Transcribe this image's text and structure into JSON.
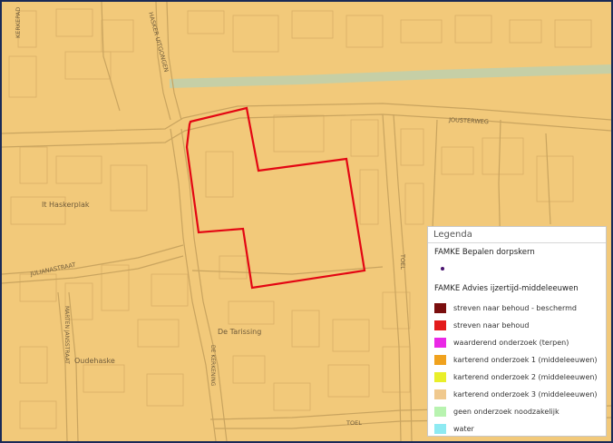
{
  "map": {
    "street_labels": {
      "kerkepad": "KERKEPAD",
      "haskerdijken": "HASKER UITGONGEN",
      "jousterweg": "JOUSTERWEG",
      "it_haskerplak": "It Haskerplak",
      "julianastraat": "JULIANASTRAAT",
      "toel_east": "TOEL",
      "marten": "MARTEN JANSSTRAAT",
      "oudehaske": "Oudehaske",
      "de_tarissing": "De Tarissing",
      "de_kerkening": "DE KERKENING",
      "toel_south": "TOEL"
    },
    "colors": {
      "base": "#f2c97a",
      "roads": "#c9a45f",
      "boundary": "#e30613",
      "water": "#c6cfa6"
    }
  },
  "legend": {
    "title": "Legenda",
    "layer1_title": "FAMKE Bepalen dorpskern",
    "layer2_title": "FAMKE Advies ijzertijd-middeleeuwen",
    "items": [
      {
        "label": "streven naar behoud - beschermd",
        "color": "#7a0e0e"
      },
      {
        "label": "streven naar behoud",
        "color": "#e31b1b"
      },
      {
        "label": "waarderend onderzoek (terpen)",
        "color": "#ea28e6"
      },
      {
        "label": "karterend onderzoek 1 (middeleeuwen)",
        "color": "#f0a21e"
      },
      {
        "label": "karterend onderzoek 2 (middeleeuwen)",
        "color": "#e9ef2a"
      },
      {
        "label": "karterend onderzoek 3 (middeleeuwen)",
        "color": "#f0c98e"
      },
      {
        "label": "geen onderzoek noodzakelijk",
        "color": "#b8f3b0"
      },
      {
        "label": "water",
        "color": "#8eeaf2"
      }
    ]
  }
}
